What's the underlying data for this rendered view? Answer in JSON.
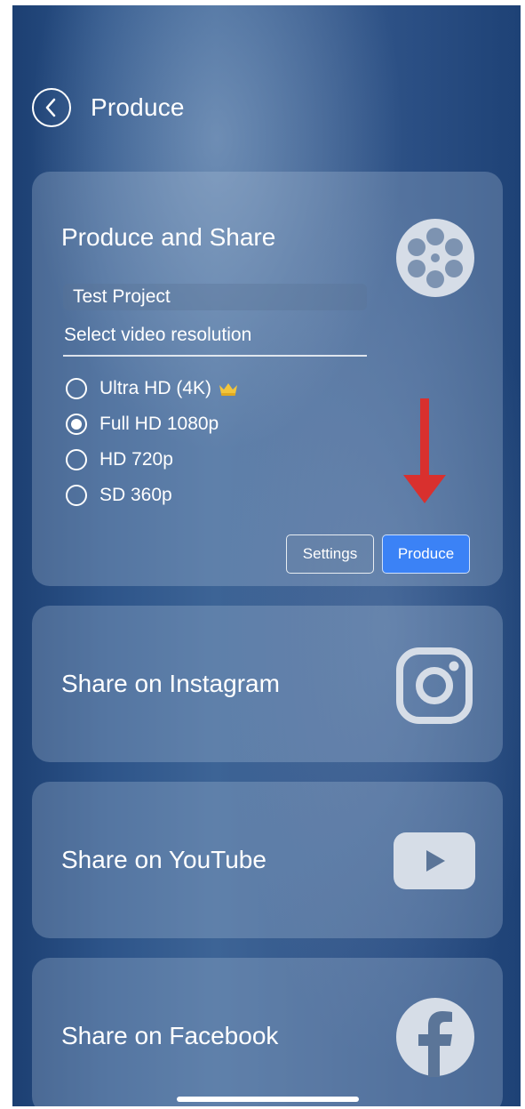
{
  "header": {
    "title": "Produce",
    "back_icon": "chevron-left-icon"
  },
  "produce_card": {
    "title": "Produce and Share",
    "icon": "film-reel-icon",
    "project_name": "Test Project",
    "resolution_label": "Select video resolution",
    "resolutions": [
      {
        "label": "Ultra HD (4K)",
        "selected": false,
        "premium": true
      },
      {
        "label": "Full HD 1080p",
        "selected": true,
        "premium": false
      },
      {
        "label": "HD 720p",
        "selected": false,
        "premium": false
      },
      {
        "label": "SD 360p",
        "selected": false,
        "premium": false
      }
    ],
    "settings_label": "Settings",
    "produce_label": "Produce",
    "annotation_arrow_color": "#d9302e",
    "produce_button_color": "#3b82f6"
  },
  "share_cards": [
    {
      "label": "Share on Instagram",
      "icon": "instagram-icon"
    },
    {
      "label": "Share on YouTube",
      "icon": "youtube-icon"
    },
    {
      "label": "Share on Facebook",
      "icon": "facebook-icon"
    }
  ]
}
